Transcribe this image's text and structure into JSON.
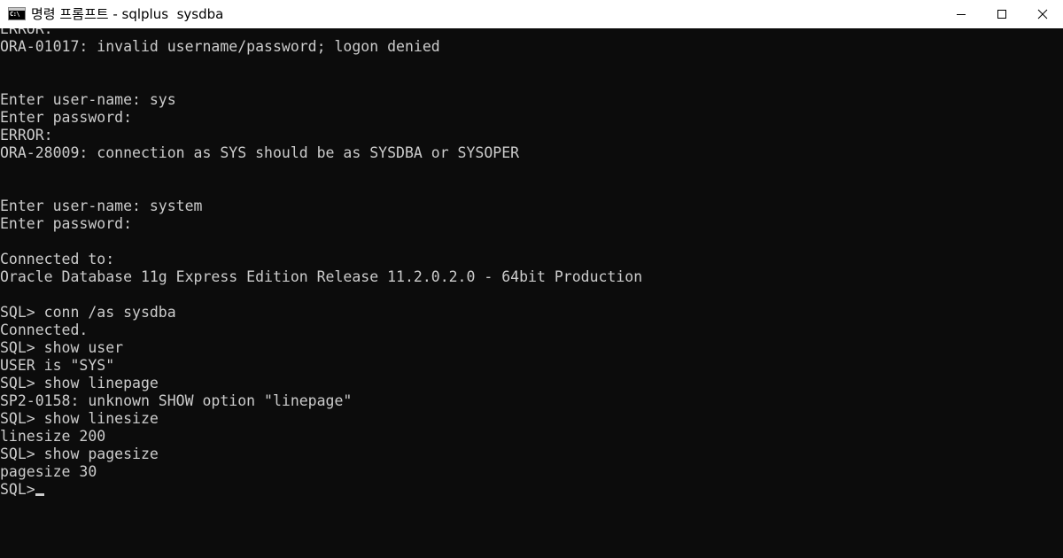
{
  "window": {
    "title": "명령 프롬프트 - sqlplus  sysdba",
    "icon": "cmd-icon",
    "icon_label": "C:\\",
    "controls": {
      "minimize_icon": "minimize-icon",
      "maximize_icon": "maximize-icon",
      "close_icon": "close-icon"
    }
  },
  "console": {
    "colors": {
      "background": "#0c0c0c",
      "text": "#cccccc"
    },
    "lines": [
      "ERROR:",
      "ORA-01017: invalid username/password; logon denied",
      "",
      "",
      "Enter user-name: sys",
      "Enter password:",
      "ERROR:",
      "ORA-28009: connection as SYS should be as SYSDBA or SYSOPER",
      "",
      "",
      "Enter user-name: system",
      "Enter password:",
      "",
      "Connected to:",
      "Oracle Database 11g Express Edition Release 11.2.0.2.0 - 64bit Production",
      "",
      "SQL> conn /as sysdba",
      "Connected.",
      "SQL> show user",
      "USER is \"SYS\"",
      "SQL> show linepage",
      "SP2-0158: unknown SHOW option \"linepage\"",
      "SQL> show linesize",
      "linesize 200",
      "SQL> show pagesize",
      "pagesize 30",
      "SQL>"
    ]
  }
}
